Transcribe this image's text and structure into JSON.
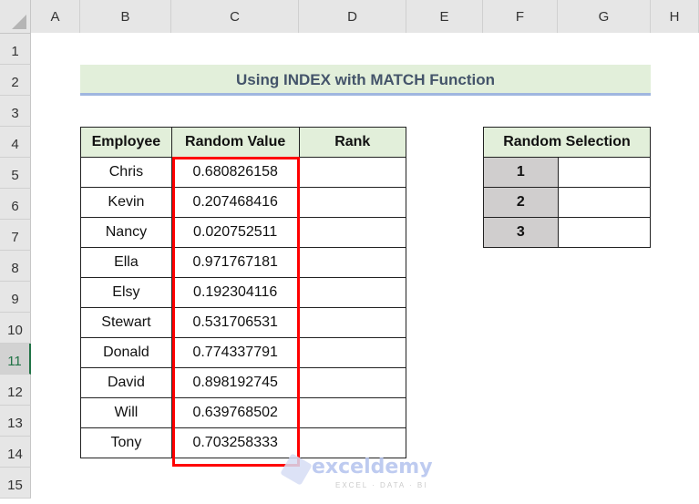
{
  "sheet": {
    "columns": [
      "A",
      "B",
      "C",
      "D",
      "E",
      "F",
      "G",
      "H"
    ],
    "rows": [
      "1",
      "2",
      "3",
      "4",
      "5",
      "6",
      "7",
      "8",
      "9",
      "10",
      "11",
      "12",
      "13",
      "14",
      "15"
    ],
    "selected_row": "11"
  },
  "title": "Using INDEX with MATCH Function",
  "main_table": {
    "headers": [
      "Employee",
      "Random Value",
      "Rank"
    ],
    "rows": [
      {
        "employee": "Chris",
        "value": "0.680826158",
        "rank": ""
      },
      {
        "employee": "Kevin",
        "value": "0.207468416",
        "rank": ""
      },
      {
        "employee": "Nancy",
        "value": "0.020752511",
        "rank": ""
      },
      {
        "employee": "Ella",
        "value": "0.971767181",
        "rank": ""
      },
      {
        "employee": "Elsy",
        "value": "0.192304116",
        "rank": ""
      },
      {
        "employee": "Stewart",
        "value": "0.531706531",
        "rank": ""
      },
      {
        "employee": "Donald",
        "value": "0.774337791",
        "rank": ""
      },
      {
        "employee": "David",
        "value": "0.898192745",
        "rank": ""
      },
      {
        "employee": "Will",
        "value": "0.639768502",
        "rank": ""
      },
      {
        "employee": "Tony",
        "value": "0.703258333",
        "rank": ""
      }
    ]
  },
  "selection_table": {
    "header": "Random Selection",
    "rows": [
      {
        "index": "1",
        "value": ""
      },
      {
        "index": "2",
        "value": ""
      },
      {
        "index": "3",
        "value": ""
      }
    ]
  },
  "watermark": {
    "name": "exceldemy",
    "tagline": "EXCEL · DATA · BI"
  },
  "colors": {
    "header_fill": "#e2efda",
    "title_text": "#44546a",
    "highlight_border": "#ff0000",
    "index_fill": "#d0cece",
    "selected_row_accent": "#217346"
  }
}
